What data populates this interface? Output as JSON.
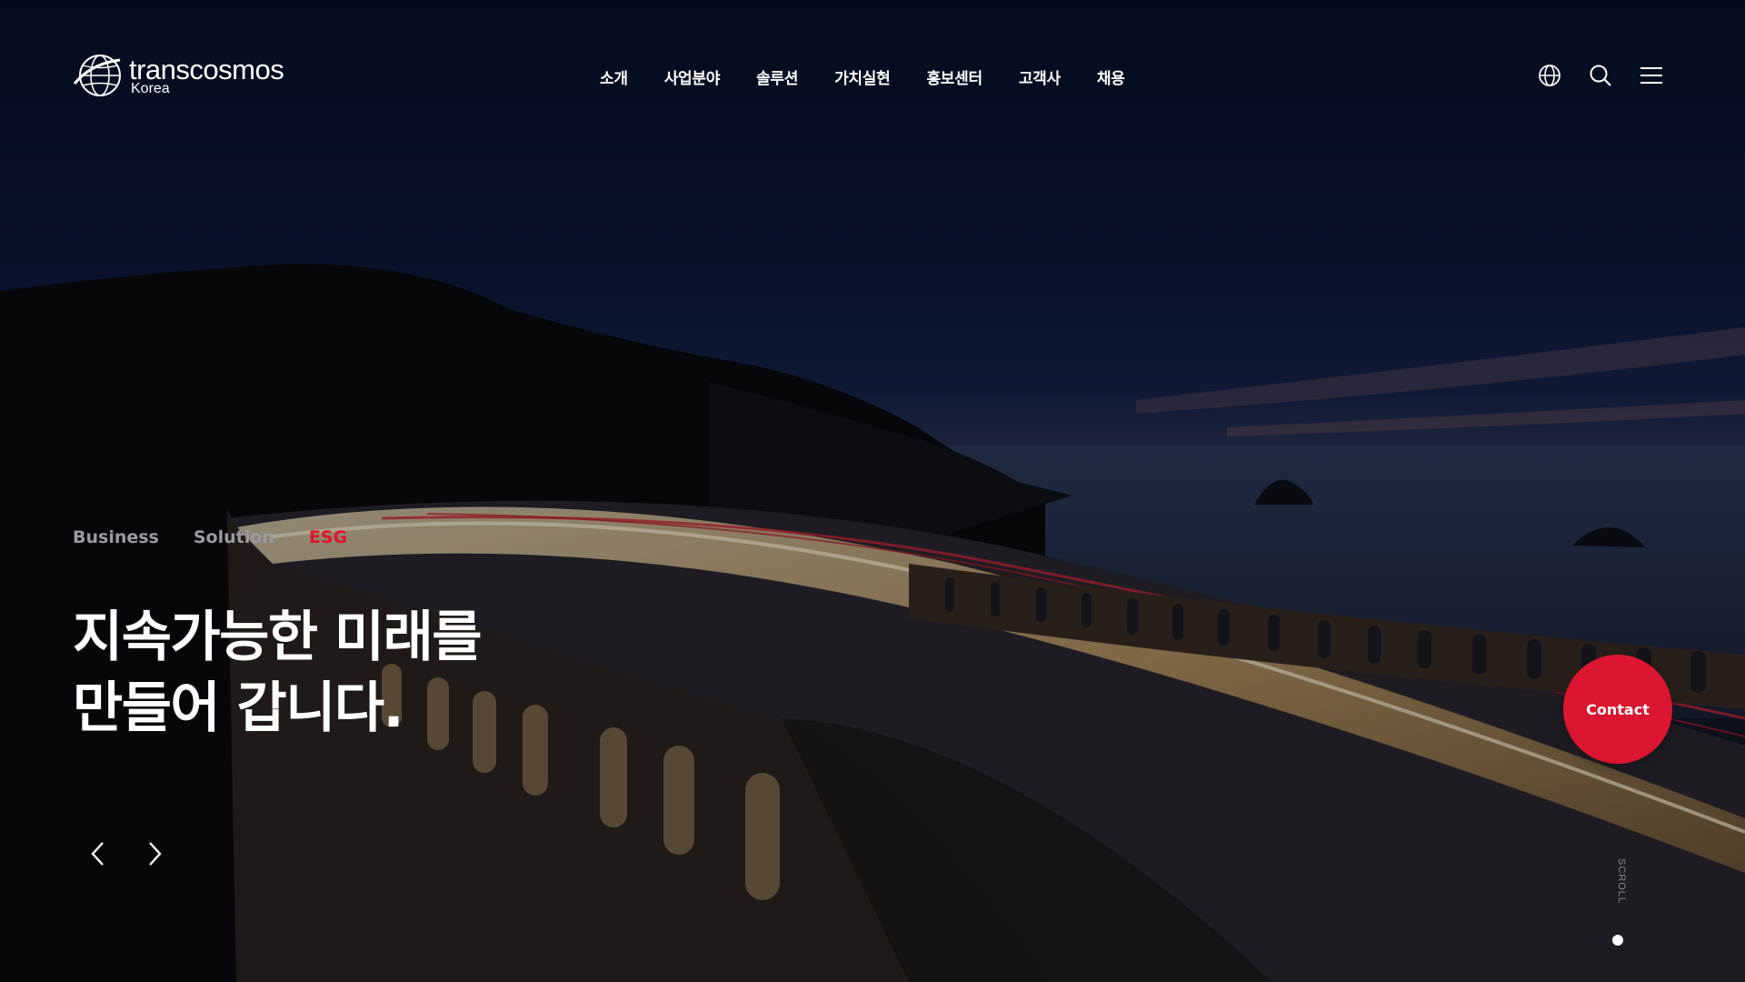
{
  "brand": {
    "name": "transcosmos",
    "sub": "Korea"
  },
  "nav": {
    "items": [
      {
        "label": "소개"
      },
      {
        "label": "사업분야"
      },
      {
        "label": "솔루션"
      },
      {
        "label": "가치실현"
      },
      {
        "label": "홍보센터"
      },
      {
        "label": "고객사"
      },
      {
        "label": "채용"
      }
    ]
  },
  "utility": {
    "icons": [
      "globe-icon",
      "search-icon",
      "menu-icon"
    ]
  },
  "hero": {
    "tabs": [
      {
        "label": "Business",
        "active": false
      },
      {
        "label": "Solution",
        "active": false
      },
      {
        "label": "ESG",
        "active": true
      }
    ],
    "headline": [
      "지속가능한 미래를",
      "만들어 갑니다."
    ]
  },
  "contact": {
    "label": "Contact"
  },
  "scroll": {
    "label": "SCROLL"
  },
  "colors": {
    "accent": "#e0162b",
    "inactive_tab": "#9a9aa2",
    "text": "#ffffff"
  }
}
